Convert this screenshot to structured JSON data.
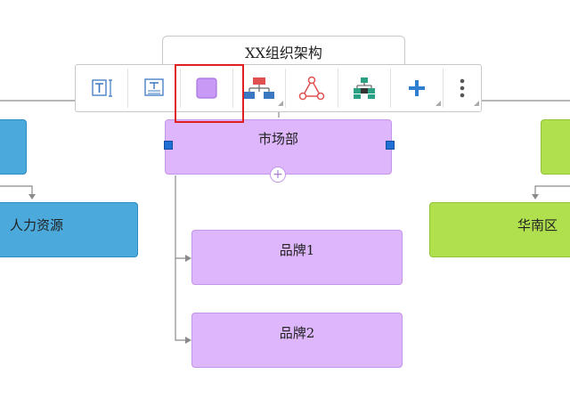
{
  "diagram": {
    "title": "XX组织架构",
    "nodes": {
      "market": "市场部",
      "hr": "人力资源",
      "south": "华南区",
      "brand1": "品牌1",
      "brand2": "品牌2"
    }
  },
  "toolbar": {
    "tools": [
      "text-style-icon",
      "text-align-icon",
      "fill-color-icon",
      "org-chart-icon",
      "relationship-icon",
      "layout-icon",
      "add-icon",
      "more-icon"
    ]
  },
  "colors": {
    "blue": "#4ba9dc",
    "green": "#b1e04f",
    "purple": "#ddb6fb",
    "highlight": "#e02020",
    "handle": "#1f6fd6"
  }
}
